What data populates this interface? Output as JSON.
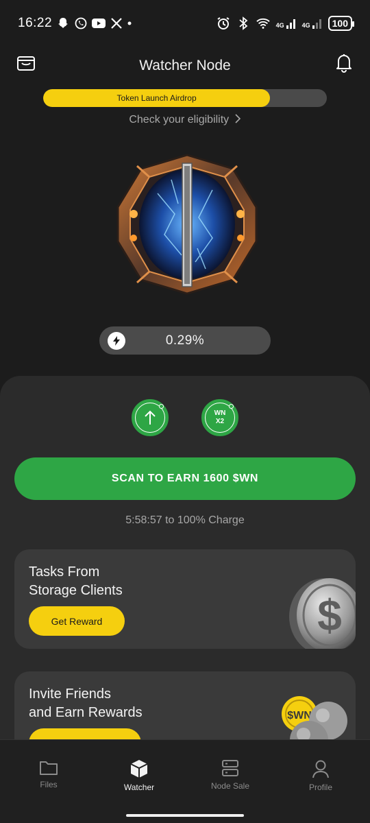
{
  "status_bar": {
    "time": "16:22",
    "network_1": "4G",
    "network_2": "4G",
    "battery": "100"
  },
  "header": {
    "title": "Watcher Node"
  },
  "airdrop": {
    "label": "Token Launch Airdrop",
    "progress_fraction": 0.8,
    "eligibility_link": "Check your eligibility"
  },
  "charge": {
    "value": "0.29%",
    "eta": "5:58:57 to 100% Charge"
  },
  "boosts": {
    "wn_label_1": "WN",
    "wn_label_2": "X2"
  },
  "scan": {
    "label": "SCAN TO EARN 1600 $WN"
  },
  "cards": [
    {
      "title_line1": "Tasks From",
      "title_line2": "Storage Clients",
      "button": "Get Reward"
    },
    {
      "title_line1": "Invite Friends",
      "title_line2": "and Earn Rewards",
      "coin_text": "$WN"
    }
  ],
  "nav": [
    {
      "label": "Files",
      "icon": "folder-icon"
    },
    {
      "label": "Watcher",
      "icon": "cube-icon"
    },
    {
      "label": "Node Sale",
      "icon": "server-icon"
    },
    {
      "label": "Profile",
      "icon": "person-icon"
    }
  ],
  "colors": {
    "background": "#1c1c1c",
    "accent_green": "#2ea645",
    "accent_yellow": "#f5cf0f",
    "card": "#3a3a3a"
  }
}
